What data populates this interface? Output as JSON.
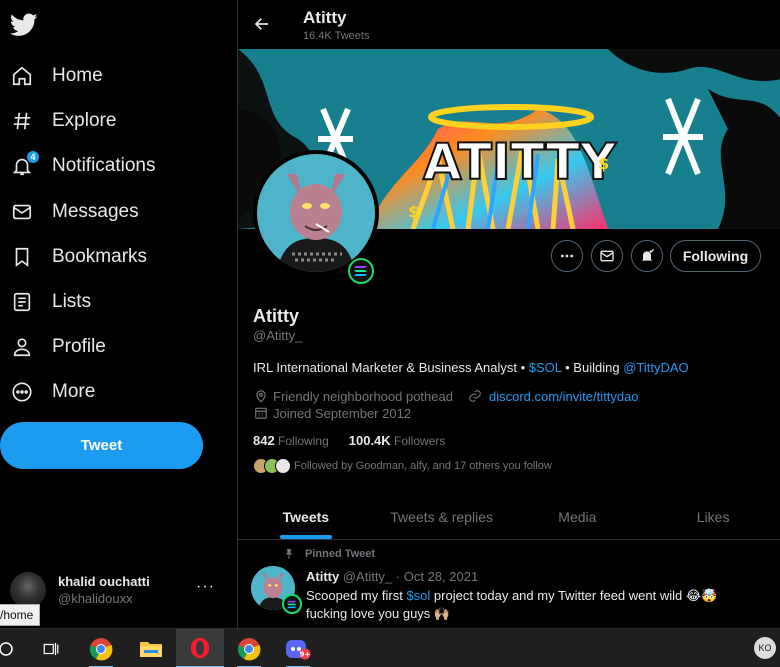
{
  "sidebar": {
    "nav": [
      {
        "label": "Home",
        "icon": "home-icon"
      },
      {
        "label": "Explore",
        "icon": "hashtag-icon"
      },
      {
        "label": "Notifications",
        "icon": "bell-icon",
        "badge": "4"
      },
      {
        "label": "Messages",
        "icon": "envelope-icon"
      },
      {
        "label": "Bookmarks",
        "icon": "bookmark-icon"
      },
      {
        "label": "Lists",
        "icon": "list-icon"
      },
      {
        "label": "Profile",
        "icon": "person-icon"
      },
      {
        "label": "More",
        "icon": "more-circle-icon"
      }
    ],
    "tweet_button": "Tweet",
    "account": {
      "name": "khalid ouchatti",
      "handle": "@khalidouxx",
      "more": "···"
    },
    "url_tooltip": "/home"
  },
  "header": {
    "title": "Atitty",
    "subtitle": "16.4K Tweets"
  },
  "profile": {
    "name": "Atitty",
    "handle": "@Atitty_",
    "bio_prefix": "IRL International Marketer & Business Analyst • ",
    "bio_cashtag": "$SOL",
    "bio_mid": " • Building ",
    "bio_mention": "@TittyDAO",
    "location": "Friendly neighborhood pothead",
    "website": "discord.com/invite/tittydao",
    "joined": "Joined September 2012",
    "following_count": "842",
    "following_label": "Following",
    "followers_count": "100.4K",
    "followers_label": "Followers",
    "followed_by": "Followed by Goodman, alfy, and 17 others you follow",
    "follow_button": "Following",
    "banner_text": "ATITTY"
  },
  "tabs": [
    "Tweets",
    "Tweets & replies",
    "Media",
    "Likes"
  ],
  "pinned_tweet": {
    "label": "Pinned Tweet",
    "name": "Atitty",
    "handle": "@Atitty_",
    "sep": " · ",
    "date": "Oct 28, 2021",
    "text_a": "Scooped my first ",
    "cashtag": "$sol",
    "text_b": " project today and my Twitter feed went wild 😂🤯",
    "text_c": "fucking love you guys 🙌🏼"
  },
  "taskbar": {
    "user_initials": "KO",
    "discord_badge": "9+",
    "items": [
      "search-circle-icon",
      "task-view-icon",
      "chrome-icon",
      "file-explorer-icon",
      "opera-icon",
      "chrome-icon",
      "discord-icon"
    ]
  },
  "colors": {
    "accent": "#1d9bf0",
    "background": "#000000",
    "muted": "#71767b",
    "text": "#e7e9ea",
    "sol_green": "#1bd96a"
  }
}
